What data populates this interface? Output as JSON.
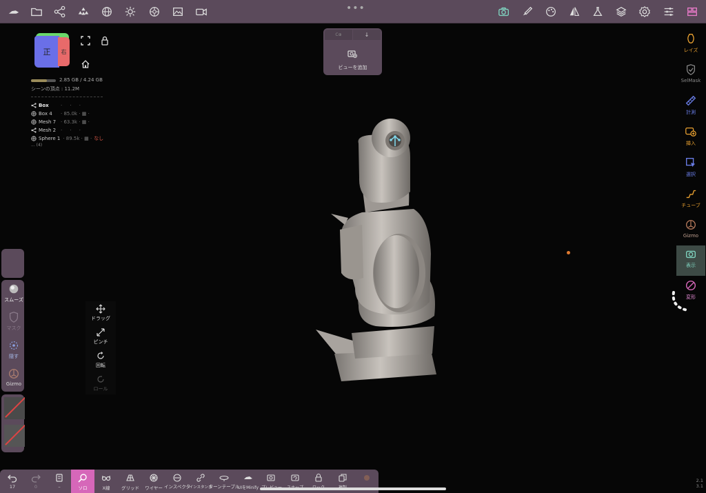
{
  "colors": {
    "bar": "#5b4a5b",
    "accent_pink": "#d667b9",
    "orange": "#e8a030",
    "teal": "#7fd4c0",
    "red": "#e05a4a"
  },
  "top": {
    "more_dots": "•••"
  },
  "cube": {
    "front": "正",
    "side": "右"
  },
  "memory": {
    "text": "2.85 GB / 4.24 GB",
    "fraction": 0.65,
    "vertices": "シーンの頂点 : 11.2M"
  },
  "scene": {
    "items": [
      {
        "name": "Box",
        "info": "",
        "none": ""
      },
      {
        "name": "Box 4",
        "info": "85.0k",
        "none": ""
      },
      {
        "name": "Mesh 7",
        "info": "63.3k",
        "none": ""
      },
      {
        "name": "Mesh 2",
        "info": "",
        "none": ""
      },
      {
        "name": "Sphere 1",
        "info": "89.5k",
        "none": "なし"
      }
    ],
    "more": "... (4)"
  },
  "viewpopup": {
    "tab1": "C⊕",
    "tab2": "↓",
    "label": "ビューを追加"
  },
  "right": {
    "items": [
      "レイズ",
      "SelMask",
      "計測",
      "挿入",
      "選択",
      "チューブ",
      "Gizmo",
      "表示",
      "変形"
    ]
  },
  "left": {
    "items": [
      "スムーズ",
      "マスク",
      "隠す",
      "Gizmo"
    ]
  },
  "gestures": {
    "items": [
      "ドラッグ",
      "ピンチ",
      "回転",
      "ロール"
    ]
  },
  "bottom": {
    "undo_count": "17",
    "redo_count": "0",
    "items": [
      "ソロ",
      "X線",
      "グリッド",
      "ワイヤー",
      "インスペクタ",
      "インスタンス",
      "ターンテーブル",
      "UIをMinify",
      "プレビュー",
      "スナップ",
      "ロック",
      "複製"
    ]
  },
  "version": {
    "line1": "2.1",
    "line2": "3.1"
  }
}
